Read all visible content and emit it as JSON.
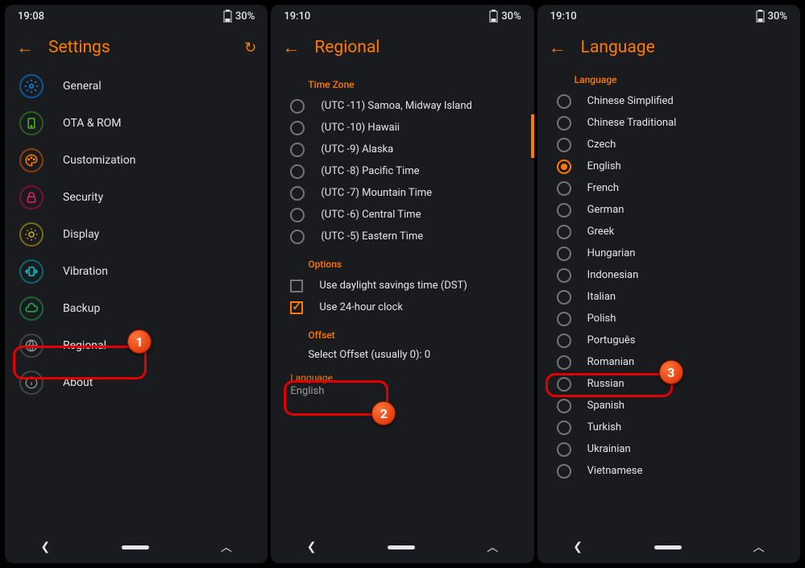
{
  "status": {
    "time1": "19:08",
    "time2": "19:10",
    "time3": "19:10",
    "battery": "30%"
  },
  "screen1": {
    "title": "Settings",
    "items": [
      {
        "label": "General"
      },
      {
        "label": "OTA & ROM"
      },
      {
        "label": "Customization"
      },
      {
        "label": "Security"
      },
      {
        "label": "Display"
      },
      {
        "label": "Vibration"
      },
      {
        "label": "Backup"
      },
      {
        "label": "Regional"
      },
      {
        "label": "About"
      }
    ]
  },
  "screen2": {
    "title": "Regional",
    "tz_header": "Time Zone",
    "tz": [
      "(UTC -11) Samoa, Midway Island",
      "(UTC -10) Hawaii",
      "(UTC -9) Alaska",
      "(UTC -8) Pacific Time",
      "(UTC -7) Mountain Time",
      "(UTC -6) Central Time",
      "(UTC -5) Eastern Time"
    ],
    "options_header": "Options",
    "opt_dst": "Use daylight savings time (DST)",
    "opt_24h": "Use 24-hour clock",
    "offset_header": "Offset",
    "offset_text": "Select Offset (usually 0): 0",
    "lang_header": "Language",
    "lang_value": "English"
  },
  "screen3": {
    "title": "Language",
    "lang_header": "Language",
    "langs": [
      "Chinese Simplified",
      "Chinese Traditional",
      "Czech",
      "English",
      "French",
      "German",
      "Greek",
      "Hungarian",
      "Indonesian",
      "Italian",
      "Polish",
      "Português",
      "Romanian",
      "Russian",
      "Spanish",
      "Turkish",
      "Ukrainian",
      "Vietnamese"
    ],
    "selected": "English",
    "highlighted": "Russian"
  },
  "badges": {
    "b1": "1",
    "b2": "2",
    "b3": "3"
  }
}
